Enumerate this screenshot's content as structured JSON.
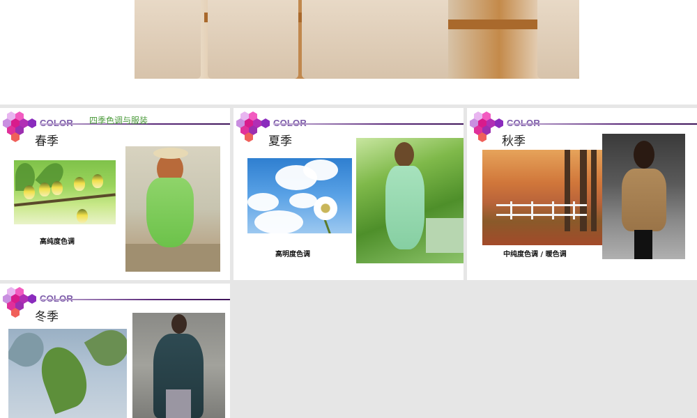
{
  "slides": [
    {
      "brand": "COLOR",
      "season": "春季",
      "subtitle": "四季色调与服装",
      "caption": "高纯度色调"
    },
    {
      "brand": "COLOR",
      "season": "夏季",
      "caption": "高明度色调"
    },
    {
      "brand": "COLOR",
      "season": "秋季",
      "caption": "中纯度色调 / 暖色调"
    },
    {
      "brand": "COLOR",
      "season": "冬季"
    }
  ],
  "colors": {
    "brand_text": "#7b5aa8",
    "rule_dark": "#3e1459",
    "subtitle_green": "#4a9a3a",
    "hex_pink": "#f25bc0",
    "hex_magenta": "#d81b8c",
    "hex_purple": "#8a2bbd",
    "hex_lilac": "#e8b5f0",
    "hex_coral": "#f0605a"
  }
}
